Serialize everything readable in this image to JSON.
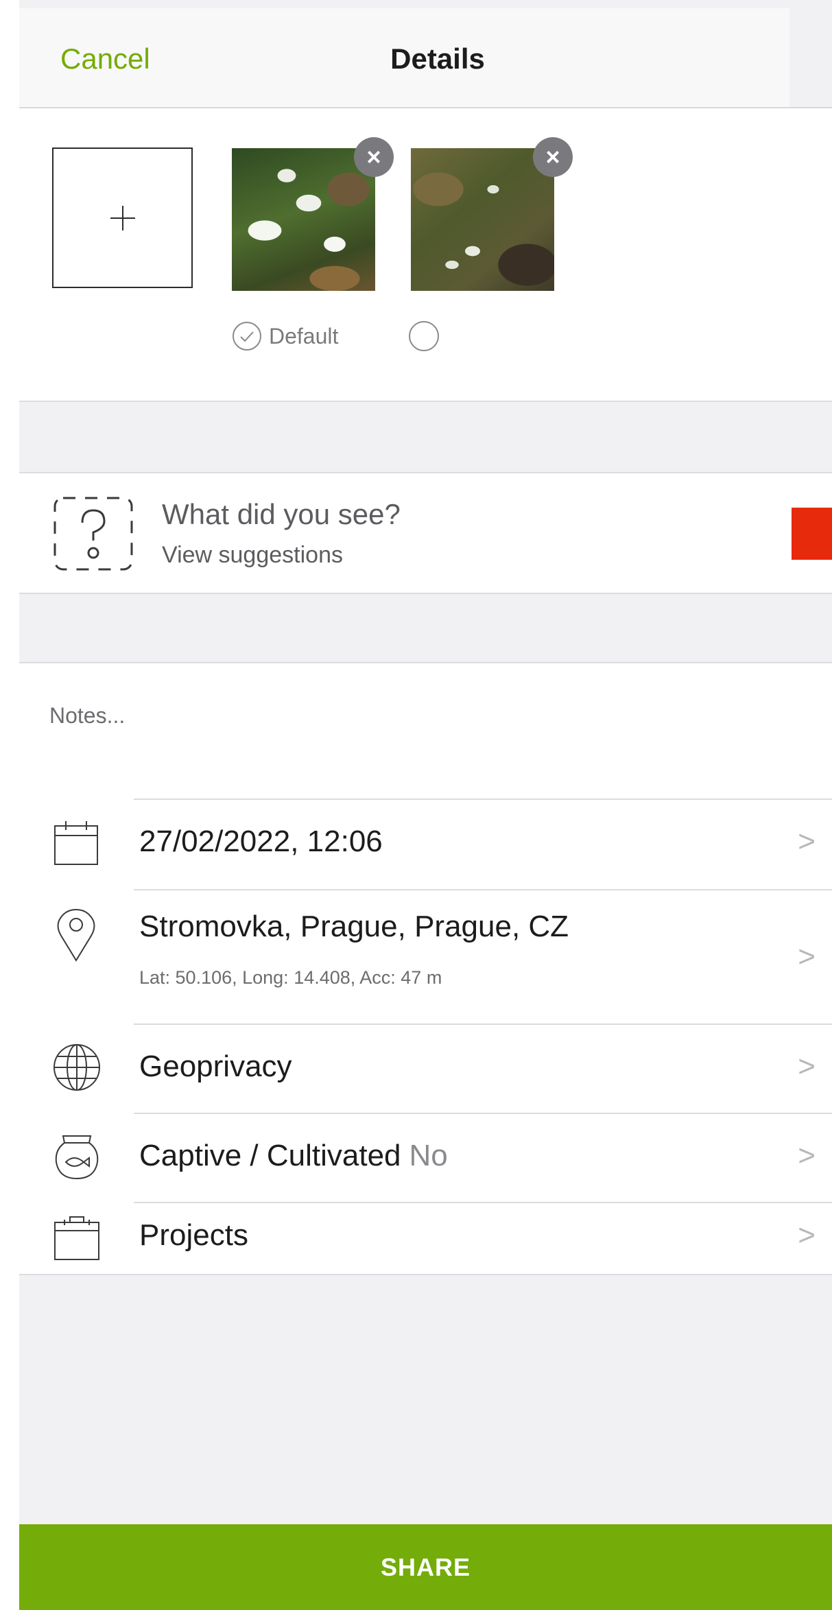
{
  "navbar": {
    "cancel_label": "Cancel",
    "title": "Details"
  },
  "photos": {
    "add_label": "+",
    "remove_glyph": "×",
    "default_label": "Default",
    "items": [
      {
        "subject": "snowdrops close-up",
        "is_default": true
      },
      {
        "subject": "snowdrops in grass",
        "is_default": false
      }
    ]
  },
  "identification": {
    "title": "What did you see?",
    "subtitle": "View suggestions"
  },
  "notes": {
    "placeholder": "Notes..."
  },
  "details": {
    "date": {
      "label": "27/02/2022, 12:06",
      "icon": "calendar-icon"
    },
    "location": {
      "label": "Stromovka, Prague, Prague, CZ",
      "coords": "Lat: 50.106, Long: 14.408, Acc: 47 m",
      "icon": "location-pin-icon"
    },
    "geoprivacy": {
      "label": "Geoprivacy",
      "icon": "globe-icon"
    },
    "captive": {
      "label": "Captive / Cultivated",
      "value": "No",
      "icon": "fishbowl-icon"
    },
    "projects": {
      "label": "Projects",
      "icon": "briefcase-icon"
    },
    "chevron": ">"
  },
  "share": {
    "label": "SHARE"
  },
  "colors": {
    "accent": "#74ac00",
    "share_bg": "#74ac0a",
    "marker": "#e82a0c",
    "section_bg": "#f1f1f3"
  }
}
